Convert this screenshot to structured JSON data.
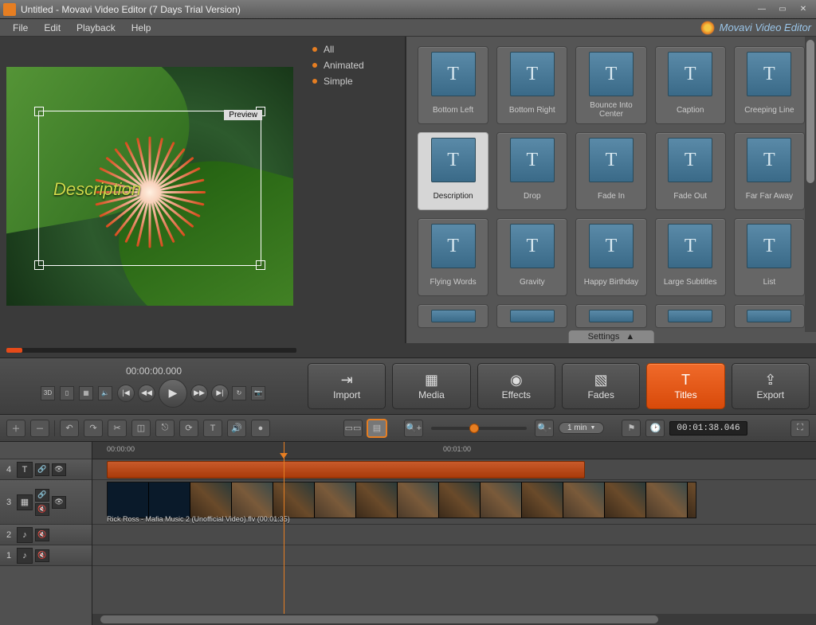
{
  "window": {
    "title": "Untitled - Movavi Video Editor (7 Days Trial Version)"
  },
  "menu": {
    "file": "File",
    "edit": "Edit",
    "playback": "Playback",
    "help": "Help",
    "brand": "Movavi Video Editor"
  },
  "preview": {
    "label": "Preview",
    "overlay": "Description",
    "timecode": "00:00:00.000"
  },
  "categories": {
    "all": "All",
    "animated": "Animated",
    "simple": "Simple"
  },
  "titles": [
    "Bottom Left",
    "Bottom Right",
    "Bounce Into Center",
    "Caption",
    "Creeping Line",
    "Description",
    "Drop",
    "Fade In",
    "Fade Out",
    "Far Far Away",
    "Flying Words",
    "Gravity",
    "Happy Birthday",
    "Large Subtitles",
    "List"
  ],
  "titles_selected_index": 5,
  "settings_label": "Settings",
  "main_buttons": {
    "import": "Import",
    "media": "Media",
    "effects": "Effects",
    "fades": "Fades",
    "titles": "Titles",
    "export": "Export"
  },
  "toolbar": {
    "zoom_label": "1 min",
    "timecode": "00:01:38.046"
  },
  "ruler": {
    "t0": "00:00:00",
    "t1": "00:01:00"
  },
  "tracks": {
    "t4": "4",
    "t3": "3",
    "t2": "2",
    "t1": "1",
    "clip_label": "Rick Ross - Mafia Music 2 (Unofficial Video).flv (00:01:35)"
  }
}
